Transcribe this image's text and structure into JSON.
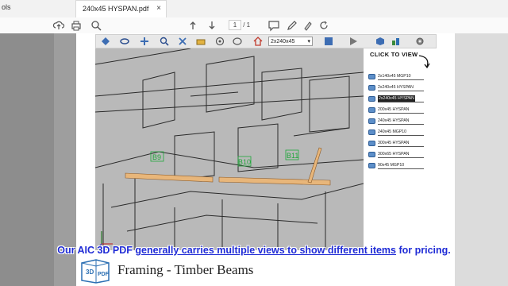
{
  "tabs": {
    "tools_label": "ols",
    "doc_label": "240x45 HYSPAN.pdf",
    "close_glyph": "×"
  },
  "toolbar": {
    "page_current": "1",
    "page_total": "/ 1",
    "icons": [
      "upload-icon",
      "print-icon",
      "search-icon",
      "zoom-in-icon",
      "comment-icon",
      "pen-icon",
      "highlight-icon",
      "rotate-icon"
    ]
  },
  "viewer3d": {
    "view_select": "2x240x45 HYSPAN",
    "icons": [
      "navigate-icon",
      "rotate-icon",
      "pan-icon",
      "zoom-icon",
      "walk-icon",
      "fly-icon",
      "spin-icon",
      "camera-icon",
      "home-icon",
      "model-tree-icon",
      "play-icon",
      "cube-icon",
      "paint-icon",
      "settings-icon"
    ]
  },
  "views_panel": {
    "title": "CLICK TO VIEW",
    "items": [
      {
        "label": "2x140x45 MGP10",
        "active": false
      },
      {
        "label": "2x240x45 HYSPAN",
        "active": false
      },
      {
        "label": "2x240x45 HYSPAN",
        "active": true
      },
      {
        "label": "200x45 HYSPAN",
        "active": false
      },
      {
        "label": "240x45 HYSPAN",
        "active": false
      },
      {
        "label": "240x45 MGP10",
        "active": false
      },
      {
        "label": "300x45 HYSPAN",
        "active": false
      },
      {
        "label": "300x65 HYSPAN",
        "active": false
      },
      {
        "label": "90x45 MGP10",
        "active": false
      }
    ]
  },
  "model": {
    "beam_labels": [
      "B9",
      "B10",
      "B11"
    ]
  },
  "caption": {
    "part1": "Our AIC 3D PDF ",
    "part2": "generally carries multiple views to show different items",
    "part3": " for pricing."
  },
  "logo": {
    "line1": "3D",
    "line2": "PDF"
  },
  "footer": {
    "title": "Framing - Timber Beams"
  },
  "colors": {
    "caption": "#1f2bd6",
    "beam": "#e8b67a",
    "label_green": "#1fa83a"
  }
}
